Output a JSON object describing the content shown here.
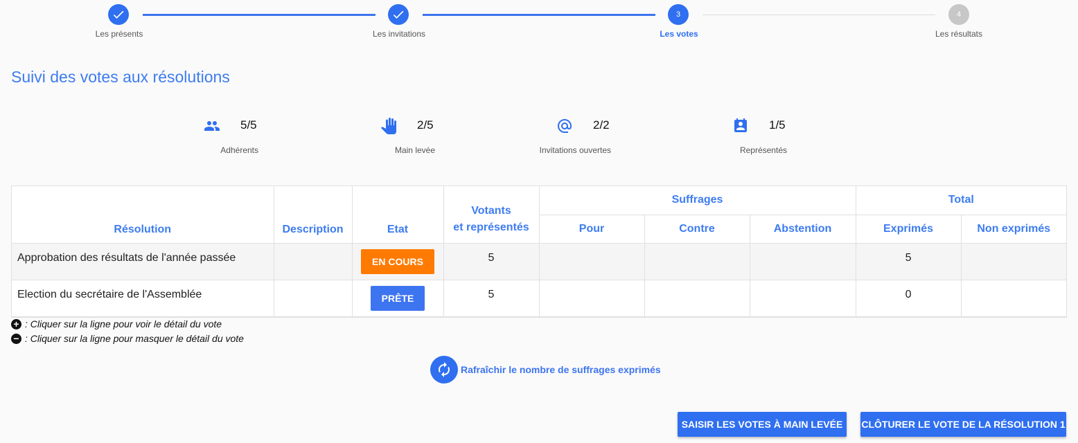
{
  "stepper": {
    "steps": [
      {
        "label": "Les présents",
        "state": "done"
      },
      {
        "label": "Les invitations",
        "state": "done"
      },
      {
        "number": "3",
        "label": "Les votes",
        "state": "active"
      },
      {
        "number": "4",
        "label": "Les résultats",
        "state": "pending"
      }
    ]
  },
  "page_title": "Suivi des votes aux résolutions",
  "stats": [
    {
      "icon": "people-icon",
      "value": "5/5",
      "label": "Adhérents"
    },
    {
      "icon": "hand-icon",
      "value": "2/5",
      "label": "Main levée"
    },
    {
      "icon": "at-icon",
      "value": "2/2",
      "label": "Invitations ouvertes"
    },
    {
      "icon": "contact-calendar-icon",
      "value": "1/5",
      "label": "Représentés"
    }
  ],
  "table": {
    "headers": {
      "resolution": "Résolution",
      "description": "Description",
      "etat": "Etat",
      "votants_line1": "Votants",
      "votants_line2": "et représentés",
      "suffrages": "Suffrages",
      "pour": "Pour",
      "contre": "Contre",
      "abstention": "Abstention",
      "total": "Total",
      "exprimes": "Exprimés",
      "non_exprimes": "Non exprimés"
    },
    "rows": [
      {
        "resolution": "Approbation des résultats de l'année passée",
        "description": "",
        "etat": "EN COURS",
        "votants": "5",
        "pour": "",
        "contre": "",
        "abstention": "",
        "exprimes": "5",
        "non_exprimes": ""
      },
      {
        "resolution": "Election du secrétaire de l'Assemblée",
        "description": "",
        "etat": "PRÊTE",
        "votants": "5",
        "pour": "",
        "contre": "",
        "abstention": "",
        "exprimes": "0",
        "non_exprimes": ""
      }
    ]
  },
  "legend": {
    "plus_text": ": Cliquer sur la ligne pour voir le détail du vote",
    "minus_text": ": Cliquer sur la ligne pour masquer le détail du vote"
  },
  "refresh_label": "Rafraîchir le nombre de suffrages exprimés",
  "actions": {
    "saisir": "SAISIR LES VOTES À MAIN LEVÉE",
    "cloturer": "CLÔTURER LE VOTE DE LA RÉSOLUTION 1"
  },
  "colors": {
    "primary": "#2f6ff0",
    "en_cours": "#ff7a00",
    "prete": "#3d74f0"
  }
}
